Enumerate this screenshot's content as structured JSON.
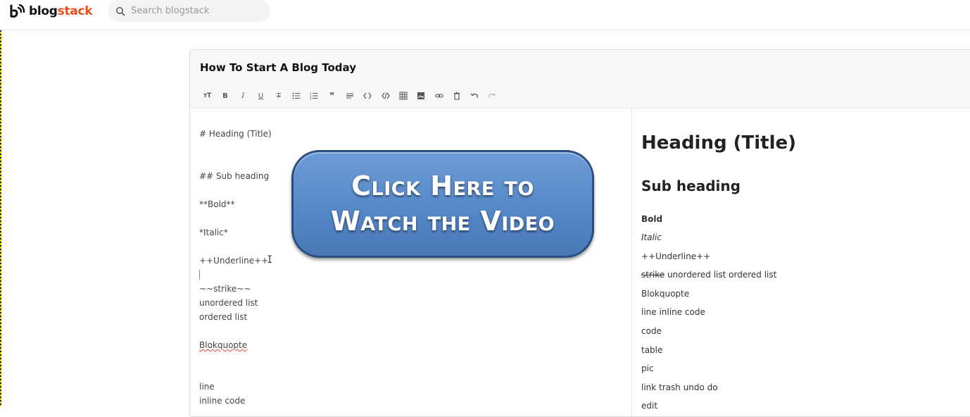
{
  "brand": {
    "name_part1": "blog",
    "name_part2": "stack",
    "accent": "#e8501a"
  },
  "search": {
    "placeholder": "Search blogstack"
  },
  "editor": {
    "title": "How To Start A Blog Today",
    "toolbar": [
      "heading-icon",
      "bold-icon",
      "italic-icon",
      "underline-icon",
      "strikethrough-icon",
      "unordered-list-icon",
      "ordered-list-icon",
      "blockquote-icon",
      "horizontal-rule-icon",
      "inline-code-icon",
      "code-block-icon",
      "table-icon",
      "image-icon",
      "link-icon",
      "trash-icon",
      "undo-icon",
      "redo-icon"
    ],
    "source": {
      "heading": "# Heading (Title)",
      "subheading": "## Sub heading",
      "bold": "**Bold**",
      "italic": "*Italic*",
      "underline": "++Underline++",
      "strike": "~~strike~~",
      "ul": "unordered list",
      "ol": "ordered list",
      "quote": "Blokquopte",
      "line": "line",
      "inline_code": "inline code"
    },
    "preview": {
      "h1": "Heading (Title)",
      "h2": "Sub heading",
      "bold": "Bold",
      "italic": "Italic",
      "underline": "++Underline++",
      "strike_word": "strike",
      "strike_rest": " unordered list ordered list",
      "quote": "Blokquopte",
      "line": "line inline code",
      "code": "code",
      "table": "table",
      "pic": "pic",
      "link": "link trash undo do",
      "edit": "edit"
    }
  },
  "overlay": {
    "line1": "Click Here to",
    "line2": "Watch the Video"
  }
}
